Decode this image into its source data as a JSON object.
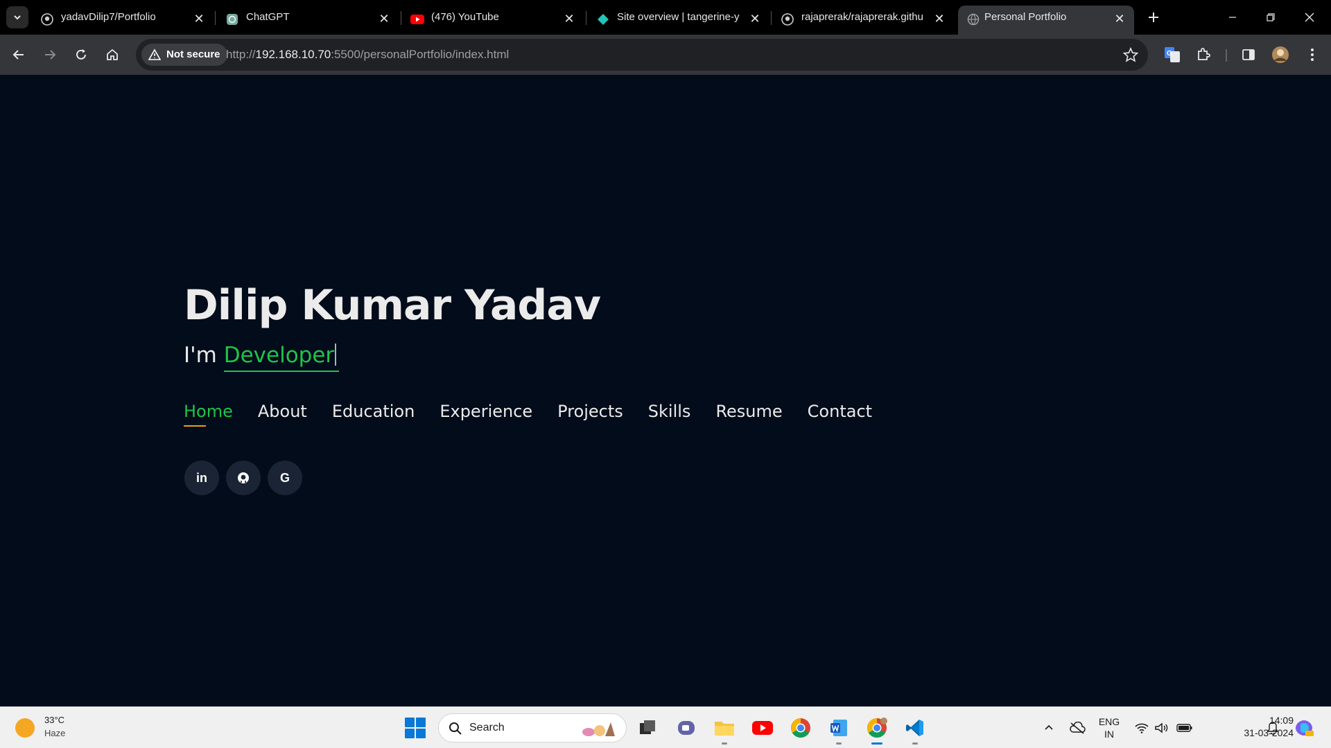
{
  "browser": {
    "tabs": [
      {
        "title": "yadavDilip7/Portfolio",
        "icon": "github-icon"
      },
      {
        "title": "ChatGPT",
        "icon": "chatgpt-icon"
      },
      {
        "title": "(476) YouTube",
        "icon": "youtube-icon"
      },
      {
        "title": "Site overview | tangerine-y",
        "icon": "netlify-icon"
      },
      {
        "title": "rajaprerak/rajaprerak.githu",
        "icon": "github-icon"
      },
      {
        "title": "Personal Portfolio",
        "icon": "globe-icon",
        "active": true
      }
    ],
    "security_label": "Not secure",
    "url_scheme": "http://",
    "url_host": "192.168.10.70",
    "url_rest": ":5500/personalPortfolio/index.html"
  },
  "hero": {
    "name": "Dilip Kumar Yadav",
    "prefix": "I'm",
    "typed_word": "Developer"
  },
  "nav": {
    "items": [
      {
        "label": "Home",
        "active": true
      },
      {
        "label": "About"
      },
      {
        "label": "Education"
      },
      {
        "label": "Experience"
      },
      {
        "label": "Projects"
      },
      {
        "label": "Skills"
      },
      {
        "label": "Resume"
      },
      {
        "label": "Contact"
      }
    ]
  },
  "socials": [
    {
      "label": "in",
      "icon": "linkedin-icon"
    },
    {
      "label": "",
      "icon": "github-icon"
    },
    {
      "label": "G",
      "icon": "google-icon"
    }
  ],
  "taskbar": {
    "weather_temp": "33°C",
    "weather_condition": "Haze",
    "search_label": "Search",
    "lang_line1": "ENG",
    "lang_line2": "IN",
    "time": "14:09",
    "date": "31-03-2024"
  },
  "colors": {
    "page_bg": "#020c1a",
    "accent_green": "#1fc44a",
    "underline_gold": "#e7a500",
    "text": "#ebebeb"
  }
}
